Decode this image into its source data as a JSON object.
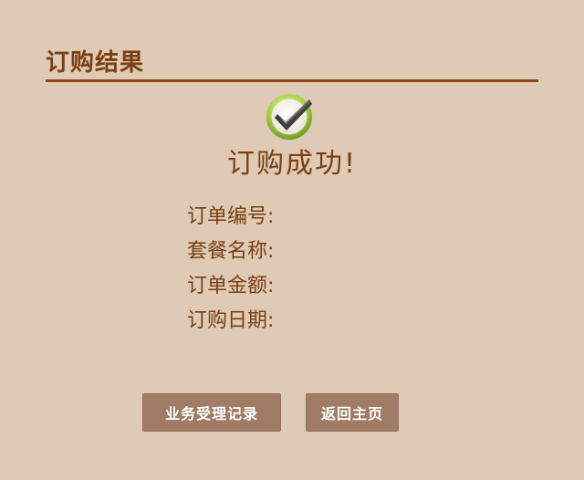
{
  "page": {
    "title": "订购结果"
  },
  "result": {
    "icon": "check-circle-icon",
    "message": "订购成功!"
  },
  "order_info": [
    {
      "label": "订单编号:",
      "value": ""
    },
    {
      "label": "套餐名称:",
      "value": ""
    },
    {
      "label": "订单金额:",
      "value": ""
    },
    {
      "label": "订购日期:",
      "value": ""
    }
  ],
  "buttons": {
    "records_label": "业务受理记录",
    "home_label": "返回主页"
  },
  "colors": {
    "background": "#decab5",
    "accent": "#7a3f12",
    "button": "#a07b65"
  }
}
